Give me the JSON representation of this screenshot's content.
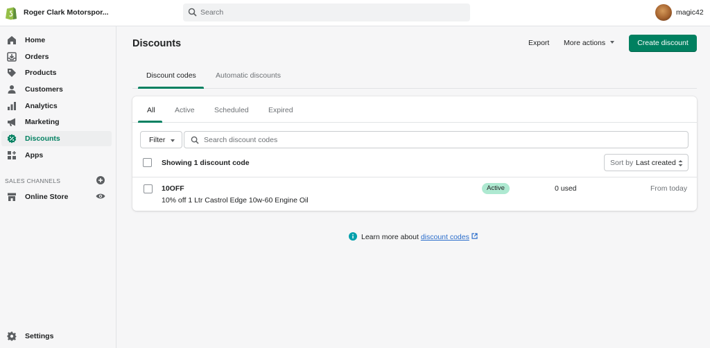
{
  "topbar": {
    "store_name": "Roger Clark Motorspor...",
    "search_placeholder": "Search",
    "username": "magic42"
  },
  "sidebar": {
    "items": [
      {
        "label": "Home",
        "icon": "home-icon"
      },
      {
        "label": "Orders",
        "icon": "orders-icon"
      },
      {
        "label": "Products",
        "icon": "tag-icon"
      },
      {
        "label": "Customers",
        "icon": "person-icon"
      },
      {
        "label": "Analytics",
        "icon": "bar-chart-icon"
      },
      {
        "label": "Marketing",
        "icon": "megaphone-icon"
      },
      {
        "label": "Discounts",
        "icon": "discount-icon",
        "active": true
      },
      {
        "label": "Apps",
        "icon": "apps-icon"
      }
    ],
    "section_title": "SALES CHANNELS",
    "channel": {
      "label": "Online Store",
      "icon": "store-icon"
    },
    "settings": {
      "label": "Settings",
      "icon": "gear-icon"
    }
  },
  "main": {
    "title": "Discounts",
    "export_label": "Export",
    "more_actions_label": "More actions",
    "create_label": "Create discount",
    "page_tabs": [
      "Discount codes",
      "Automatic discounts"
    ],
    "filter_tabs": [
      "All",
      "Active",
      "Scheduled",
      "Expired"
    ],
    "filter_label": "Filter",
    "search_placeholder": "Search discount codes",
    "showing_text": "Showing 1 discount code",
    "sort_prefix": "Sort by",
    "sort_value": "Last created",
    "discounts": [
      {
        "code": "10OFF",
        "description": "10% off 1 Ltr Castrol Edge 10w-60 Engine Oil",
        "status": "Active",
        "used": "0 used",
        "date": "From today"
      }
    ],
    "learn_more_text": "Learn more about ",
    "learn_more_link": "discount codes"
  },
  "colors": {
    "accent": "#008060",
    "badge_success": "#aee9d1",
    "link": "#2c6ecb",
    "info": "#00a0ac"
  }
}
